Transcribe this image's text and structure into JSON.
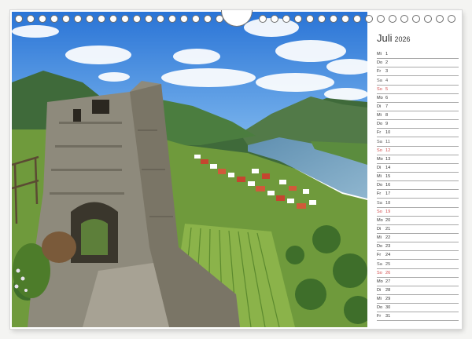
{
  "calendar": {
    "month": "Juli",
    "year": "2026",
    "days": [
      {
        "wd": "Mi",
        "d": "1",
        "type": "weekday"
      },
      {
        "wd": "Do",
        "d": "2",
        "type": "weekday"
      },
      {
        "wd": "Fr",
        "d": "3",
        "type": "weekday"
      },
      {
        "wd": "Sa",
        "d": "4",
        "type": "sat"
      },
      {
        "wd": "So",
        "d": "5",
        "type": "sun"
      },
      {
        "wd": "Mo",
        "d": "6",
        "type": "weekday"
      },
      {
        "wd": "Di",
        "d": "7",
        "type": "weekday"
      },
      {
        "wd": "Mi",
        "d": "8",
        "type": "weekday"
      },
      {
        "wd": "Do",
        "d": "9",
        "type": "weekday"
      },
      {
        "wd": "Fr",
        "d": "10",
        "type": "weekday"
      },
      {
        "wd": "Sa",
        "d": "11",
        "type": "sat"
      },
      {
        "wd": "So",
        "d": "12",
        "type": "sun"
      },
      {
        "wd": "Mo",
        "d": "13",
        "type": "weekday"
      },
      {
        "wd": "Di",
        "d": "14",
        "type": "weekday"
      },
      {
        "wd": "Mi",
        "d": "15",
        "type": "weekday"
      },
      {
        "wd": "Do",
        "d": "16",
        "type": "weekday"
      },
      {
        "wd": "Fr",
        "d": "17",
        "type": "weekday"
      },
      {
        "wd": "Sa",
        "d": "18",
        "type": "sat"
      },
      {
        "wd": "So",
        "d": "19",
        "type": "sun"
      },
      {
        "wd": "Mo",
        "d": "20",
        "type": "weekday"
      },
      {
        "wd": "Di",
        "d": "21",
        "type": "weekday"
      },
      {
        "wd": "Mi",
        "d": "22",
        "type": "weekday"
      },
      {
        "wd": "Do",
        "d": "23",
        "type": "weekday"
      },
      {
        "wd": "Fr",
        "d": "24",
        "type": "weekday"
      },
      {
        "wd": "Sa",
        "d": "25",
        "type": "sat"
      },
      {
        "wd": "So",
        "d": "26",
        "type": "sun"
      },
      {
        "wd": "Mo",
        "d": "27",
        "type": "weekday"
      },
      {
        "wd": "Di",
        "d": "28",
        "type": "weekday"
      },
      {
        "wd": "Mi",
        "d": "29",
        "type": "weekday"
      },
      {
        "wd": "Do",
        "d": "30",
        "type": "weekday"
      },
      {
        "wd": "Fr",
        "d": "31",
        "type": "weekday"
      }
    ]
  },
  "colors": {
    "sunday": "#d24a4a",
    "text": "#333333",
    "rule": "#a8a8a8"
  },
  "photo": {
    "subject": "castle-ruin-above-river-valley-photo"
  }
}
